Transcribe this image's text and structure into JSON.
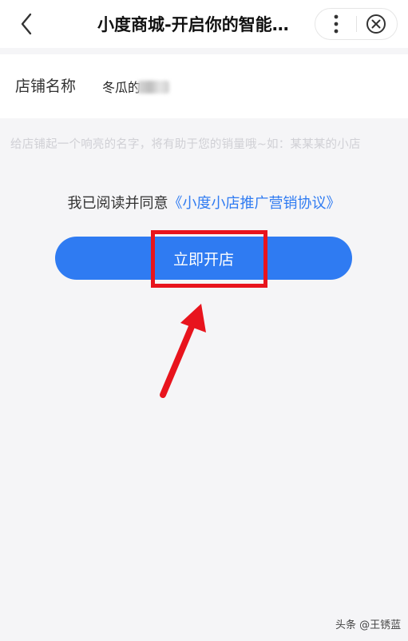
{
  "header": {
    "title": "小度商城-开启你的智能…",
    "back_icon": "chevron-left-icon",
    "more_icon": "more-vertical-icon",
    "close_icon": "close-circle-icon"
  },
  "form": {
    "shop_name_label": "店铺名称",
    "shop_name_value": "冬瓜的",
    "hint": "给店铺起一个响亮的名字，将有助于您的销量哦~如：某某某的小店"
  },
  "agreement": {
    "prefix": "我已阅读并同意",
    "link": "《小度小店推广营销协议》"
  },
  "primary_button": {
    "label": "立即开店"
  },
  "watermark": {
    "text": "头条 @王锈蓝"
  },
  "colors": {
    "accent": "#2f7bf2",
    "annotation": "#e8141d",
    "background": "#f5f5f7"
  }
}
